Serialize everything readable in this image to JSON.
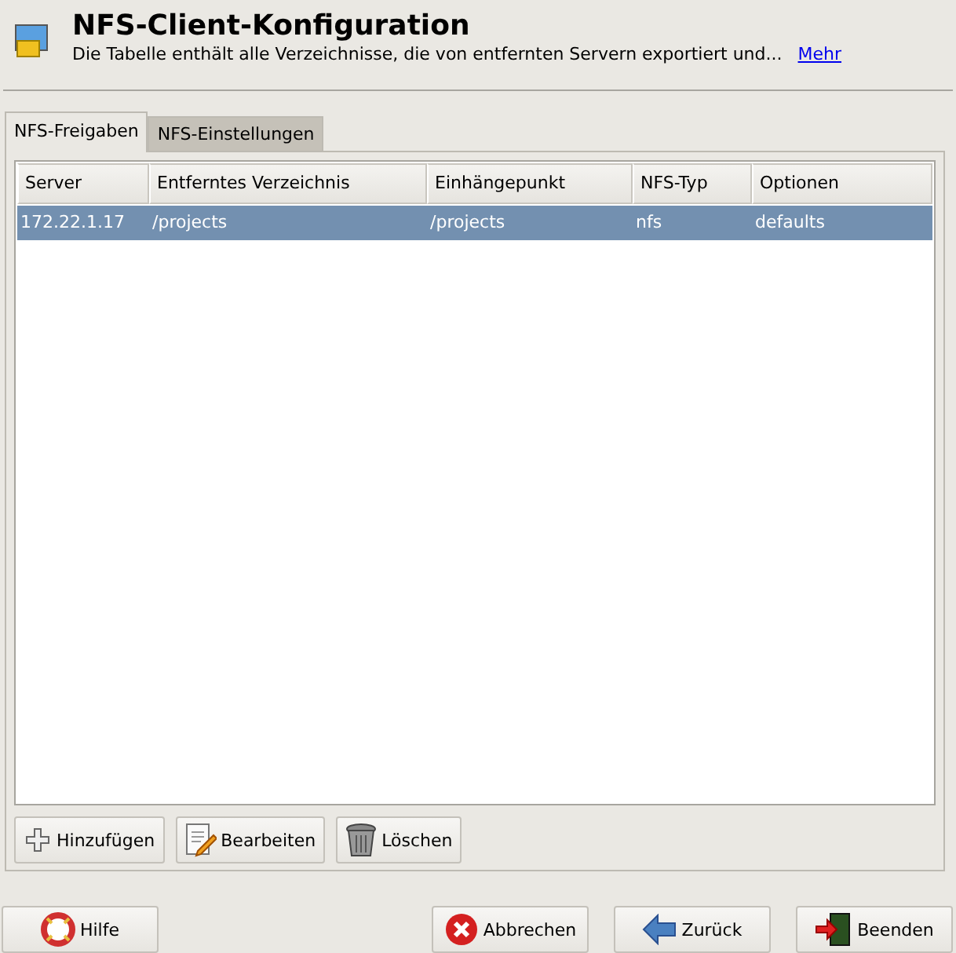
{
  "header": {
    "title": "NFS-Client-Konfiguration",
    "description": "Die Tabelle enthält alle Verzeichnisse, die von entfernten Servern exportiert und...",
    "link": "Mehr"
  },
  "tabs": [
    {
      "label": "NFS-Freigaben",
      "selected": true
    },
    {
      "label": "NFS-Einstellungen",
      "selected": false
    }
  ],
  "table": {
    "columns": [
      "Server",
      "Entferntes Verzeichnis",
      "Einhängepunkt",
      "NFS-Typ",
      "Optionen"
    ],
    "rows": [
      {
        "cells": [
          "172.22.1.17",
          "/projects",
          "/projects",
          "nfs",
          "defaults"
        ],
        "selected": true
      }
    ]
  },
  "table_buttons": [
    {
      "kind": "add",
      "label": "Hinzufügen"
    },
    {
      "kind": "edit",
      "label": "Bearbeiten"
    },
    {
      "kind": "delete",
      "label": "Löschen"
    }
  ],
  "footer": {
    "help": {
      "kind": "help",
      "label": "Hilfe"
    },
    "actions": [
      {
        "kind": "cancel",
        "label": "Abbrechen"
      },
      {
        "kind": "back",
        "label": "Zurück"
      },
      {
        "kind": "finish",
        "label": "Beenden"
      }
    ]
  }
}
